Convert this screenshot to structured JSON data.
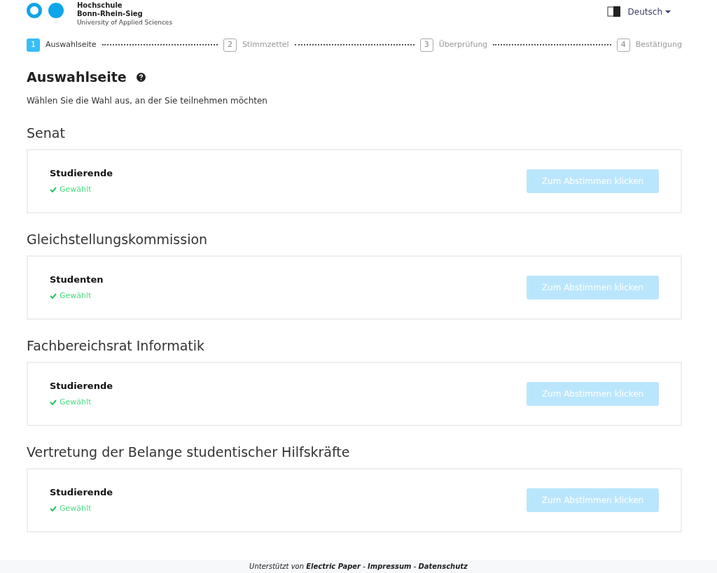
{
  "header": {
    "logo_lines": [
      "Hochschule",
      "Bonn-Rhein-Sieg",
      "University of Applied Sciences"
    ],
    "language": "Deutsch"
  },
  "steps": [
    {
      "number": "1",
      "label": "Auswahlseite",
      "selected": true
    },
    {
      "number": "2",
      "label": "Stimmzettel",
      "selected": false
    },
    {
      "number": "3",
      "label": "Überprüfung",
      "selected": false
    },
    {
      "number": "4",
      "label": "Bestätigung",
      "selected": false
    }
  ],
  "page": {
    "title": "Auswahlseite",
    "subtitle": "Wählen Sie die Wahl aus, an der Sie teilnehmen möchten"
  },
  "elections": [
    {
      "section": "Senat",
      "group": "Studierende",
      "voted": true,
      "status": "Gewählt",
      "button": {
        "label": "Zum Abstimmen klicken",
        "disabled": true
      }
    },
    {
      "section": "Gleichstellungskommission",
      "group": "Studenten",
      "voted": true,
      "status": "Gewählt",
      "button": {
        "label": "Zum Abstimmen klicken",
        "disabled": true
      }
    },
    {
      "section": "Fachbereichsrat Informatik",
      "group": "Studierende",
      "voted": true,
      "status": "Gewählt",
      "button": {
        "label": "Zum Abstimmen klicken",
        "disabled": true
      }
    },
    {
      "section": "Vertretung der Belange studentischer Hilfskräfte",
      "group": "Studierende",
      "voted": true,
      "status": "Gewählt",
      "button": {
        "label": "Zum Abstimmen klicken",
        "disabled": true
      }
    }
  ],
  "footer": "Unterstützt von **Electric Paper** - **Impressum** - **Datenschutz**"
}
